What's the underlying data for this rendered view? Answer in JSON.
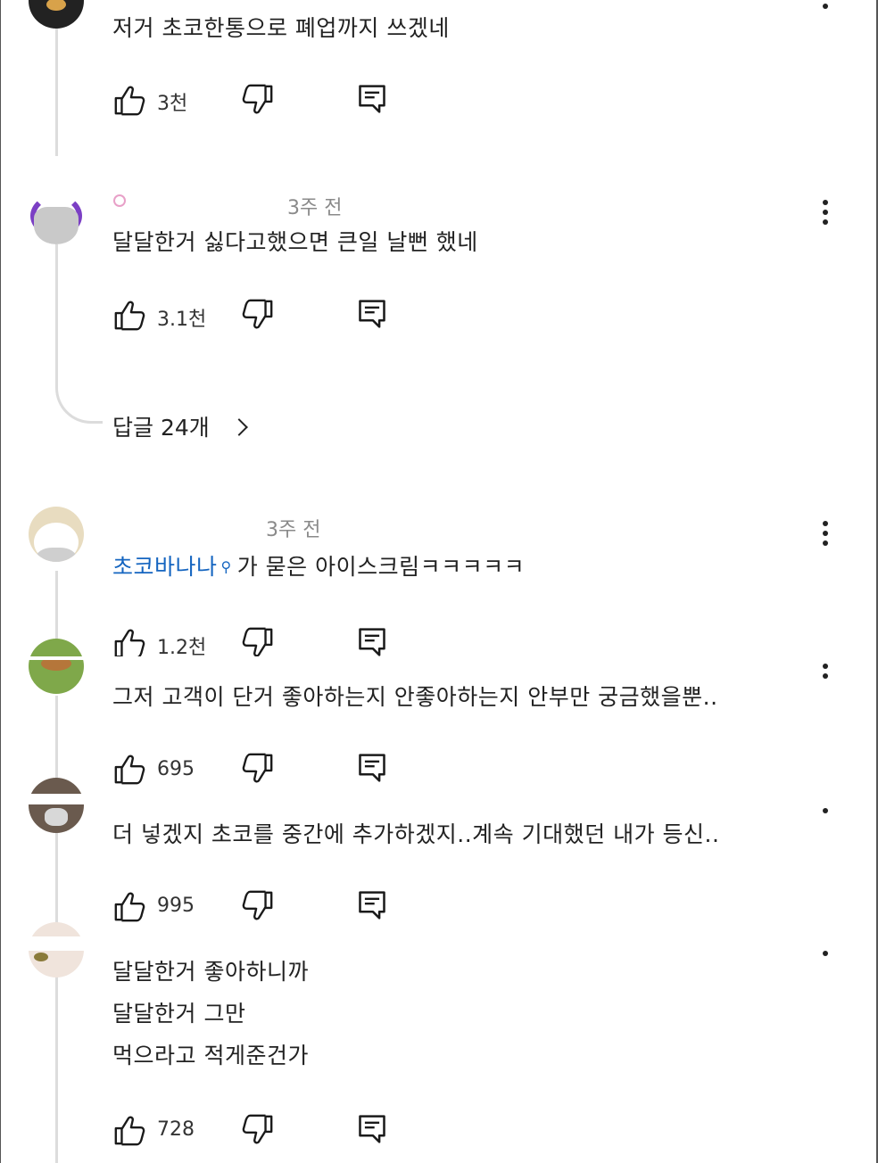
{
  "comments": [
    {
      "meta": "",
      "lines": [
        "저거 초코한통으로 폐업까지 쓰겠네"
      ],
      "likes": "3천"
    },
    {
      "meta": "3주 전",
      "lines": [
        "달달한거 싫다고했으면 큰일 날뻔 했네"
      ],
      "likes": "3.1천",
      "replies_label": "답글 24개"
    },
    {
      "meta": "3주 전",
      "mention": "초코바나나",
      "text_after": "가 묻은 아이스크림ㅋㅋㅋㅋㅋ",
      "likes": "1.2천"
    },
    {
      "meta": "",
      "lines": [
        "그저 고객이 단거 좋아하는지 안좋아하는지 안부만 궁금했을뿐.."
      ],
      "likes": "695"
    },
    {
      "meta": "",
      "lines": [
        "더 넣겠지 초코를 중간에 추가하겠지..계속 기대했던 내가 등신.."
      ],
      "likes": "995"
    },
    {
      "meta": "",
      "lines": [
        "달달한거 좋아하니까",
        "달달한거 그만",
        "먹으라고 적게준건가"
      ],
      "likes": "728"
    }
  ],
  "icons": {
    "like": "thumbs-up-icon",
    "dislike": "thumbs-down-icon",
    "reply": "reply-icon",
    "more": "more-vert-icon",
    "chevron": "chevron-right-icon"
  },
  "colors": {
    "mention": "#1565c0",
    "meta": "#8a8a8a",
    "thread": "#dcdcdc"
  }
}
